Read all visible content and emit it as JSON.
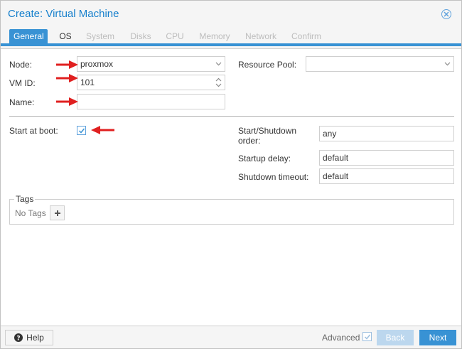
{
  "window": {
    "title": "Create: Virtual Machine"
  },
  "tabs": [
    {
      "label": "General",
      "state": "active"
    },
    {
      "label": "OS",
      "state": "enabled"
    },
    {
      "label": "System",
      "state": "disabled"
    },
    {
      "label": "Disks",
      "state": "disabled"
    },
    {
      "label": "CPU",
      "state": "disabled"
    },
    {
      "label": "Memory",
      "state": "disabled"
    },
    {
      "label": "Network",
      "state": "disabled"
    },
    {
      "label": "Confirm",
      "state": "disabled"
    }
  ],
  "form": {
    "node_label": "Node:",
    "node_value": "proxmox",
    "vmid_label": "VM ID:",
    "vmid_value": "101",
    "name_label": "Name:",
    "name_value": "",
    "resource_pool_label": "Resource Pool:",
    "resource_pool_value": "",
    "start_at_boot_label": "Start at boot:",
    "start_at_boot_checked": true,
    "start_order_label_line1": "Start/Shutdown",
    "start_order_label_line2": "order:",
    "start_order_value": "any",
    "startup_delay_label": "Startup delay:",
    "startup_delay_value": "default",
    "shutdown_timeout_label": "Shutdown timeout:",
    "shutdown_timeout_value": "default"
  },
  "tags": {
    "legend": "Tags",
    "empty_text": "No Tags"
  },
  "footer": {
    "help_label": "Help",
    "advanced_label": "Advanced",
    "advanced_checked": true,
    "back_label": "Back",
    "next_label": "Next"
  },
  "colors": {
    "accent": "#3892d4",
    "title": "#157fcc",
    "annotation_arrow": "#e02020"
  },
  "icons": {
    "close": "close-circle-icon",
    "help": "question-circle-icon",
    "add_tag": "plus-icon",
    "dropdown": "chevron-down-icon",
    "spinner": "spinner-arrows-icon",
    "check": "checkmark-icon",
    "annotation": "red-arrow-icon"
  }
}
